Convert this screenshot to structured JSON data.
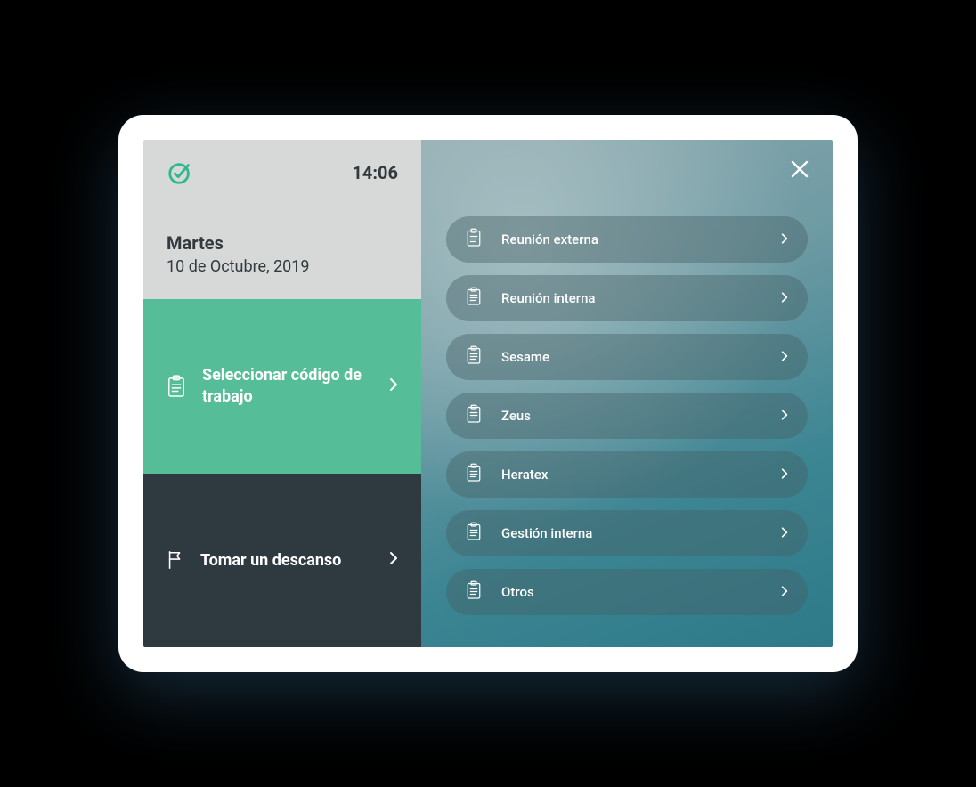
{
  "header": {
    "time": "14:06",
    "day": "Martes",
    "date": "10 de Octubre, 2019"
  },
  "actions": {
    "select_code_label": "Seleccionar código de trabajo",
    "break_label": "Tomar un descanso"
  },
  "work_codes": [
    {
      "label": "Reunión externa"
    },
    {
      "label": "Reunión interna"
    },
    {
      "label": "Sesame"
    },
    {
      "label": "Zeus"
    },
    {
      "label": "Heratex"
    },
    {
      "label": "Gestión interna"
    },
    {
      "label": "Otros"
    }
  ],
  "colors": {
    "accent": "#55bd97",
    "dark": "#2f3a40"
  }
}
